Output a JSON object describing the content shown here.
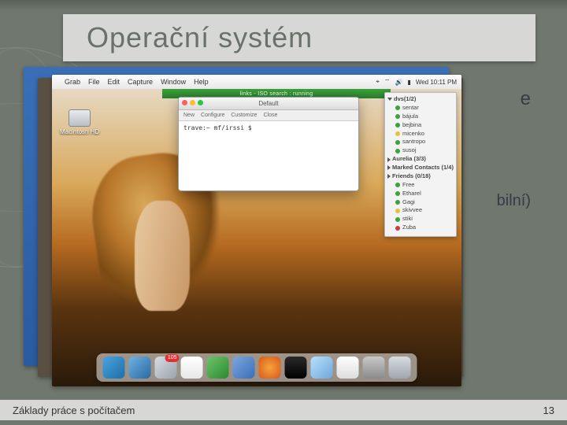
{
  "slide": {
    "title": "Operační systém",
    "footer_text": "Základy práce s počítačem",
    "page_number": "13",
    "peek_fragment_1": "e",
    "peek_fragment_2": "bilní)"
  },
  "mac": {
    "menubar": {
      "apple": "",
      "items": [
        "Grab",
        "File",
        "Edit",
        "Capture",
        "Window",
        "Help"
      ],
      "clock": "Wed 10:11 PM"
    },
    "green_strip_text": "links - ISO search : running",
    "hd_label": "Macintosh HD",
    "terminal": {
      "title": "Default",
      "toolbar": [
        "New",
        "Configure",
        "Customize",
        "Close"
      ],
      "prompt": "trave:~ mf/irssi $"
    },
    "buddy_list": {
      "groups": [
        {
          "name": "dvs(1/2)",
          "open": true,
          "items": [
            {
              "dot": "g",
              "name": "sentar"
            },
            {
              "dot": "g",
              "name": "bájula"
            },
            {
              "dot": "g",
              "name": "bejbina"
            },
            {
              "dot": "y",
              "name": "micenko"
            },
            {
              "dot": "g",
              "name": "santropo"
            },
            {
              "dot": "g",
              "name": "susoj"
            }
          ]
        },
        {
          "name": "Aurelia (3/3)",
          "open": false,
          "items": []
        },
        {
          "name": "Marked Contacts (1/4)",
          "open": false,
          "items": []
        },
        {
          "name": "Friends (0/18)",
          "open": false,
          "items": []
        },
        {
          "name": "",
          "open": true,
          "items": [
            {
              "dot": "g",
              "name": "Free"
            },
            {
              "dot": "g",
              "name": "Etharel"
            },
            {
              "dot": "g",
              "name": "Gagi"
            },
            {
              "dot": "y",
              "name": "skivvee"
            },
            {
              "dot": "g",
              "name": "stiki"
            },
            {
              "dot": "r",
              "name": "Zuba"
            }
          ]
        }
      ]
    },
    "dock": [
      {
        "name": "finder-icon",
        "color": "linear-gradient(135deg,#4aa3df,#1e6fa8)"
      },
      {
        "name": "safari-icon",
        "color": "linear-gradient(135deg,#6fb2e4,#2a6aa0)"
      },
      {
        "name": "mail-icon",
        "color": "linear-gradient(135deg,#d8dde2,#9aa4ad)",
        "badge": "105"
      },
      {
        "name": "ical-icon",
        "color": "linear-gradient(#fff,#e8e8e8)"
      },
      {
        "name": "ichat-icon",
        "color": "linear-gradient(135deg,#6fc36f,#2a8a2a)"
      },
      {
        "name": "itunes-icon",
        "color": "linear-gradient(135deg,#7aa7e0,#3a6fb7)"
      },
      {
        "name": "firefox-icon",
        "color": "radial-gradient(circle,#f5a33a,#d9571a)"
      },
      {
        "name": "terminal-icon",
        "color": "linear-gradient(#2a2a2a,#000)"
      },
      {
        "name": "preview-icon",
        "color": "linear-gradient(135deg,#b8e0ff,#6fa8d8)"
      },
      {
        "name": "textedit-icon",
        "color": "linear-gradient(#fff,#ddd)"
      },
      {
        "name": "sysprefs-icon",
        "color": "linear-gradient(#c8c8c8,#8a8a8a)"
      },
      {
        "name": "trash-icon",
        "color": "linear-gradient(#d8dde2,#a0a6ad)"
      }
    ]
  }
}
